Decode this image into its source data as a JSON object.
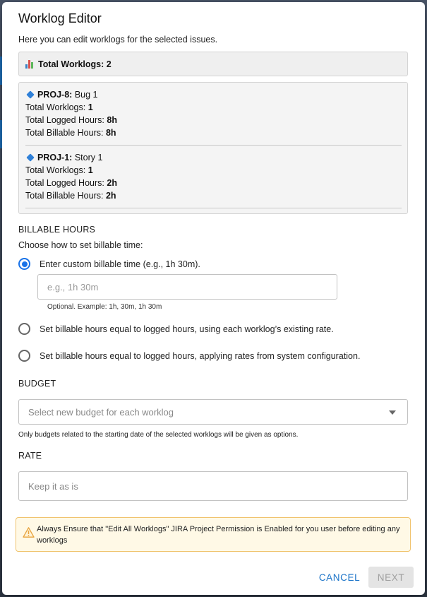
{
  "dialog": {
    "title": "Worklog Editor",
    "description": "Here you can edit worklogs for the selected issues."
  },
  "summary": {
    "icon": "bar-chart-icon",
    "total_label": "Total Worklogs: 2"
  },
  "issues": [
    {
      "key": "PROJ-8:",
      "name": "Bug 1",
      "worklogs_label": "Total Worklogs:",
      "worklogs": "1",
      "logged_label": "Total Logged Hours:",
      "logged": "8h",
      "billable_label": "Total Billable Hours:",
      "billable": "8h"
    },
    {
      "key": "PROJ-1:",
      "name": "Story 1",
      "worklogs_label": "Total Worklogs:",
      "worklogs": "1",
      "logged_label": "Total Logged Hours:",
      "logged": "2h",
      "billable_label": "Total Billable Hours:",
      "billable": "2h"
    }
  ],
  "billable": {
    "section_title": "BILLABLE HOURS",
    "prompt": "Choose how to set billable time:",
    "options": [
      {
        "label": "Enter custom billable time (e.g., 1h 30m).",
        "selected": true
      },
      {
        "label": "Set billable hours equal to logged hours, using each worklog’s existing rate.",
        "selected": false
      },
      {
        "label": "Set billable hours equal to logged hours, applying rates from system configuration.",
        "selected": false
      }
    ],
    "input_placeholder": "e.g., 1h 30m",
    "input_value": "",
    "hint": "Optional. Example: 1h, 30m, 1h 30m"
  },
  "budget": {
    "section_title": "BUDGET",
    "placeholder": "Select new budget for each worklog",
    "note": "Only budgets related to the starting date of the selected worklogs will be given as options."
  },
  "rate": {
    "section_title": "RATE",
    "placeholder": "Keep it as is",
    "value": ""
  },
  "warning": {
    "icon": "warning-triangle-icon",
    "text": "Always Ensure that \"Edit All Worklogs\" JIRA Project Permission is Enabled for you user before editing any worklogs"
  },
  "actions": {
    "cancel_label": "CANCEL",
    "next_label": "NEXT"
  },
  "colors": {
    "accent": "#1a73e8",
    "issue_type": "#2f80d8",
    "warning_bg": "#fff9e6",
    "warning_border": "#f0c36d"
  }
}
